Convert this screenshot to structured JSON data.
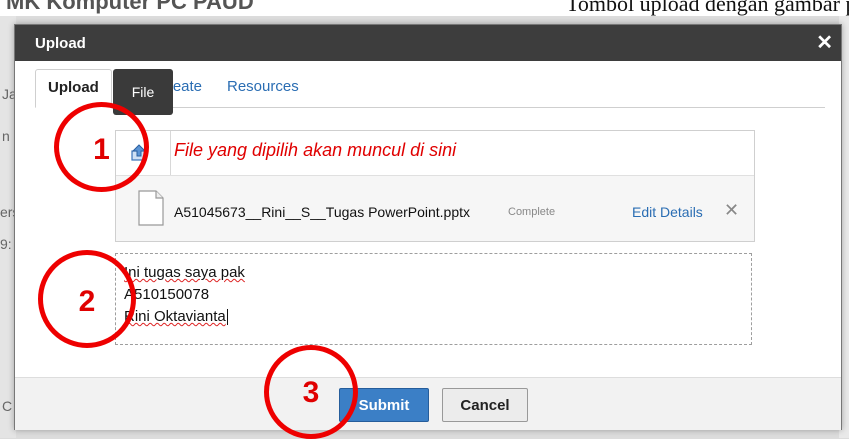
{
  "background": {
    "title": "MK Komputer PC PAUD",
    "caption_text": "Tombol upload dengan gambar panah ke atas yang",
    "left_fragments": [
      "Ja",
      "n",
      "ers",
      "9:",
      "C"
    ]
  },
  "modal": {
    "title": "Upload",
    "close_icon": "close-icon"
  },
  "tabs": [
    {
      "label": "Upload",
      "active": true
    },
    {
      "label": "Create"
    },
    {
      "label": "Resources"
    }
  ],
  "tooltip": "File",
  "upload": {
    "annotation": "File yang dipilih akan muncul di sini",
    "file": {
      "name": "A51045673__Rini__S__Tugas PowerPoint.pptx",
      "status": "Complete",
      "edit_label": "Edit Details",
      "remove_symbol": "✕"
    }
  },
  "comment": {
    "lines": [
      "Ini tugas saya pak",
      "A510150078",
      "Rini Oktavianta"
    ]
  },
  "buttons": {
    "submit": "Submit",
    "cancel": "Cancel"
  },
  "markers": [
    "1",
    "2",
    "3"
  ],
  "colors": {
    "header": "#3d3d3d",
    "accent": "#2a6db3",
    "annotation": "#ee0000",
    "submit": "#3b7fc6"
  }
}
